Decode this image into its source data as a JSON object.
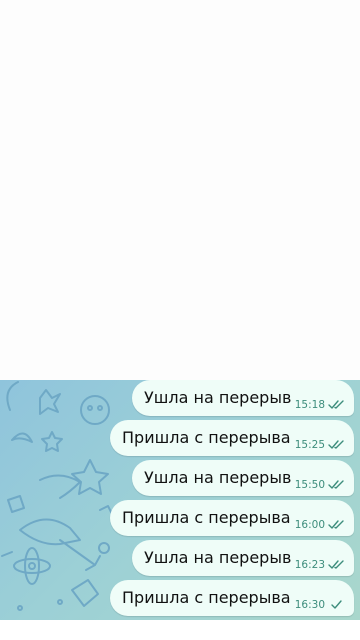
{
  "chat": {
    "messages": [
      {
        "text": "Ушла на перерыв",
        "time": "15:18",
        "status": "read"
      },
      {
        "text": "Пришла с перерыва",
        "time": "15:25",
        "status": "read"
      },
      {
        "text": "Ушла на перерыв",
        "time": "15:50",
        "status": "read"
      },
      {
        "text": "Пришла с перерыва",
        "time": "16:00",
        "status": "read"
      },
      {
        "text": "Ушла на перерыв",
        "time": "16:23",
        "status": "read"
      },
      {
        "text": "Пришла с перерыва",
        "time": "16:30",
        "status": "sent"
      }
    ]
  },
  "colors": {
    "bubble": "#effdf8",
    "time": "#3d8d7c",
    "wallpaper_start": "#8fc4dc",
    "wallpaper_end": "#a9d7cc"
  },
  "icons": {
    "read": "double-check-icon",
    "sent": "check-icon"
  }
}
